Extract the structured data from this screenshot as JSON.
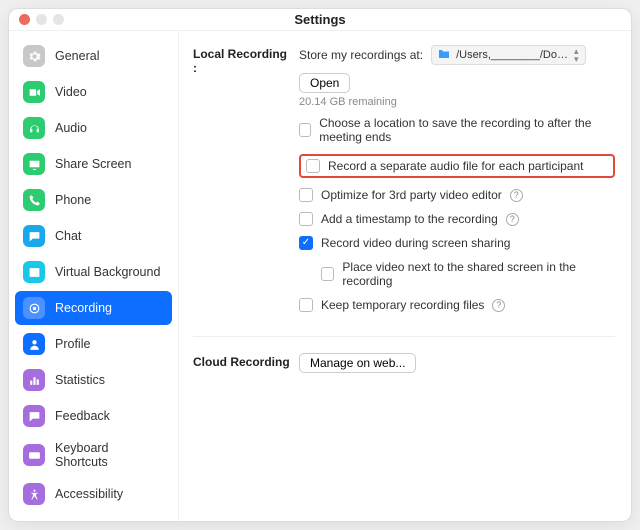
{
  "title": "Settings",
  "sidebar": {
    "items": [
      {
        "label": "General",
        "icon": "gear",
        "color": "#c8c8c8"
      },
      {
        "label": "Video",
        "icon": "video",
        "color": "#2ecc71"
      },
      {
        "label": "Audio",
        "icon": "audio",
        "color": "#2ecc71"
      },
      {
        "label": "Share Screen",
        "icon": "share",
        "color": "#2ecc71"
      },
      {
        "label": "Phone",
        "icon": "phone",
        "color": "#2ecc71"
      },
      {
        "label": "Chat",
        "icon": "chat",
        "color": "#18a8ec"
      },
      {
        "label": "Virtual Background",
        "icon": "vb",
        "color": "#18c8e8"
      },
      {
        "label": "Recording",
        "icon": "recording",
        "color": "#0e6eff",
        "selected": true
      },
      {
        "label": "Profile",
        "icon": "profile",
        "color": "#0e6eff"
      },
      {
        "label": "Statistics",
        "icon": "stats",
        "color": "#a56dde"
      },
      {
        "label": "Feedback",
        "icon": "feedback",
        "color": "#a56dde"
      },
      {
        "label": "Keyboard Shortcuts",
        "icon": "keyboard",
        "color": "#a56dde"
      },
      {
        "label": "Accessibility",
        "icon": "accessibility",
        "color": "#a56dde"
      }
    ]
  },
  "local": {
    "title": "Local Recording :",
    "store_label": "Store my recordings at:",
    "path_display": "/Users,________/Do…",
    "open_btn": "Open",
    "remaining": "20.14 GB remaining",
    "opts": {
      "choose_location": "Choose a location to save the recording to after the meeting ends",
      "separate_audio": "Record a separate audio file for each participant",
      "optimize_3rd": "Optimize for 3rd party video editor",
      "timestamp": "Add a timestamp to the recording",
      "record_video_share": "Record video during screen sharing",
      "place_video_next": "Place video next to the shared screen in the recording",
      "keep_temp": "Keep temporary recording files"
    },
    "checked": {
      "record_video_share": true
    }
  },
  "cloud": {
    "title": "Cloud Recording",
    "manage_btn": "Manage on web..."
  }
}
